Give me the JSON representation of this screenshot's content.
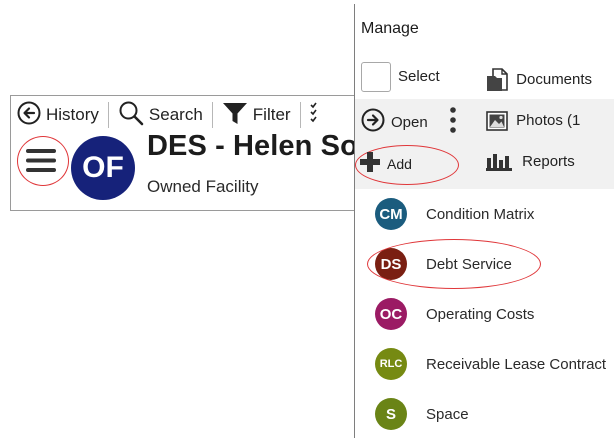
{
  "toolbar": {
    "history_label": "History",
    "search_label": "Search",
    "filter_label": "Filter"
  },
  "record": {
    "avatar_initials": "OF",
    "avatar_color": "#16227a",
    "title": "DES - Helen So",
    "type": "Owned Facility"
  },
  "manage": {
    "title": "Manage",
    "select_label": "Select",
    "documents_label": "Documents",
    "open_label": "Open",
    "photos_label": "Photos (1",
    "add_label": "Add",
    "reports_label": "Reports"
  },
  "add_items": [
    {
      "initials": "CM",
      "label": "Condition Matrix",
      "color": "#1b5c7e"
    },
    {
      "initials": "DS",
      "label": "Debt Service",
      "color": "#7a1f12"
    },
    {
      "initials": "OC",
      "label": "Operating Costs",
      "color": "#9b1b64"
    },
    {
      "initials": "RLC",
      "label": "Receivable Lease Contract",
      "color": "#768a12"
    },
    {
      "initials": "S",
      "label": "Space",
      "color": "#6a8416"
    }
  ],
  "highlight_color": "#e0373a"
}
